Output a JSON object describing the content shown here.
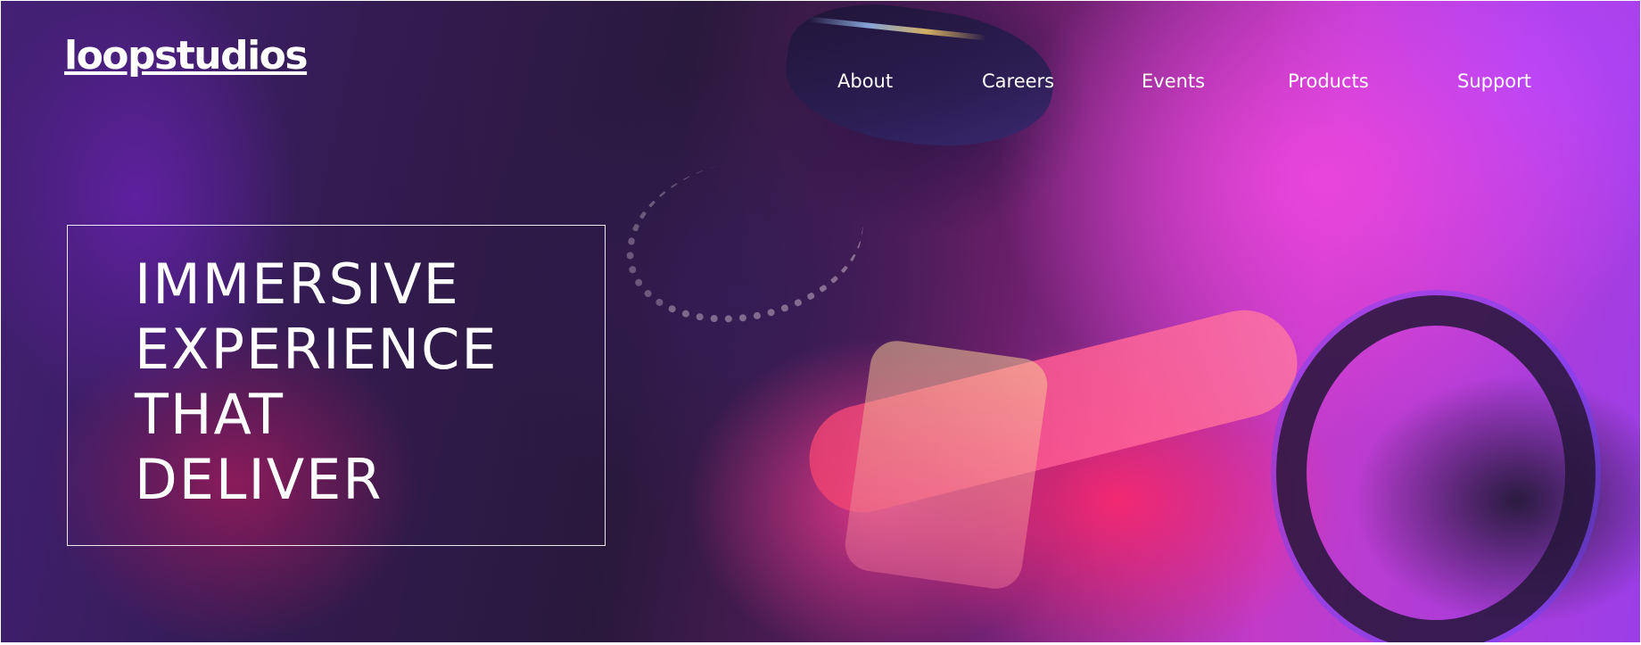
{
  "brand": {
    "logo_text": "loopstudios"
  },
  "nav": {
    "items": [
      {
        "label": "About"
      },
      {
        "label": "Careers"
      },
      {
        "label": "Events"
      },
      {
        "label": "Products"
      },
      {
        "label": "Support"
      }
    ]
  },
  "hero": {
    "headline_lines": [
      "IMMERSIVE",
      "EXPERIENCE",
      "THAT",
      "DELIVER"
    ],
    "background_image": "vr-headset-driving-photo",
    "colors": {
      "text": "#ffffff",
      "magenta": "#e146dc",
      "violet": "#9b3ee8",
      "pink": "#ff2870",
      "dark": "#2a1a3e"
    }
  }
}
